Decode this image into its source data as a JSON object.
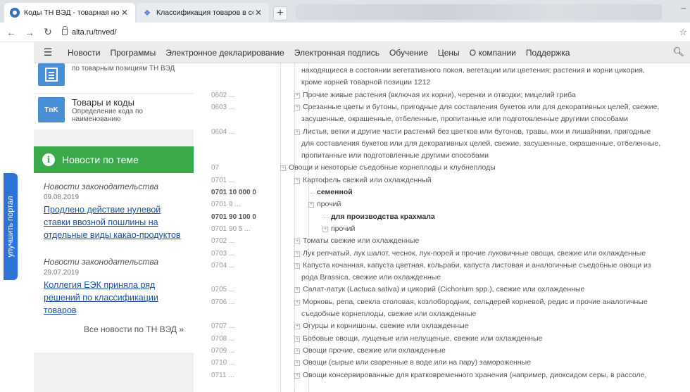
{
  "browser": {
    "tabs": [
      {
        "title": "Коды ТН ВЭД - товарная номе",
        "active": true
      },
      {
        "title": "Классификация товаров в соот",
        "active": false
      }
    ],
    "url": "alta.ru/tnved/"
  },
  "menu": {
    "items": [
      "Новости",
      "Программы",
      "Электронное декларирование",
      "Электронная подпись",
      "Обучение",
      "Цены",
      "О компании",
      "Поддержка"
    ]
  },
  "sidebar": {
    "service1": {
      "subtitle": "по товарным позициям ТН ВЭД"
    },
    "service2": {
      "icon_text": "TnK",
      "title": "Товары и коды",
      "subtitle": "Определение кода по наименованию"
    },
    "news_header": "Новости по теме",
    "news": [
      {
        "category": "Новости законодательства",
        "date": "09.08.2019",
        "link": "Продлено действие нулевой ставки ввозной пошлины на отдельные виды какао-продуктов"
      },
      {
        "category": "Новости законодательства",
        "date": "29.07.2019",
        "link": "Коллегия ЕЭК приняла ряд решений по классификации товаров"
      }
    ],
    "all_news": "Все новости по ТН ВЭД »",
    "side_tab": "улучшить портал"
  },
  "tree": {
    "rows": [
      {
        "code": "",
        "desc": "находящиеся в состоянии вегетативного покоя, вегетации или цветения; растения и корни цикория,",
        "bold": false
      },
      {
        "code": "",
        "desc": "кроме корней товарной позиции 1212",
        "bold": false
      },
      {
        "code": "0602 ...",
        "desc": "Прочие живые растения (включая их корни), черенки и отводки; мицелий гриба",
        "bold": false
      },
      {
        "code": "0603 ...",
        "desc": "Срезанные цветы и бутоны, пригодные для составления букетов или для декоративных целей, свежие,",
        "bold": false
      },
      {
        "code": "",
        "desc": "засушенные, окрашенные, отбеленные, пропитанные или подготовленные другими способами",
        "bold": false
      },
      {
        "code": "0604 ...",
        "desc": "Листья, ветки и другие части растений без цветков или бутонов, травы, мхи и лишайники, пригодные",
        "bold": false
      },
      {
        "code": "",
        "desc": "для составления букетов или для декоративных целей, свежие, засушенные, окрашенные, отбеленные,",
        "bold": false
      },
      {
        "code": "",
        "desc": "пропитанные или подготовленные другими способами",
        "bold": false
      },
      {
        "code": "07",
        "desc": "Овощи и некоторые съедобные корнеплоды и клубнеплоды",
        "bold": false
      },
      {
        "code": "0701 ...",
        "desc": "Картофель свежий или охлажденный",
        "bold": false
      },
      {
        "code": "0701 10 000 0",
        "desc": "семенной",
        "bold": true
      },
      {
        "code": "0701 9 ...",
        "desc": "прочий",
        "bold": false
      },
      {
        "code": "0701 90 100 0",
        "desc": "для производства крахмала",
        "bold": true
      },
      {
        "code": "0701 90 5 ...",
        "desc": "прочий",
        "bold": false
      },
      {
        "code": "0702 ...",
        "desc": "Томаты свежие или охлажденные",
        "bold": false
      },
      {
        "code": "0703 ...",
        "desc": "Лук репчатый, лук шалот, чеснок, лук-порей и прочие луковичные овощи, свежие или охлажденные",
        "bold": false
      },
      {
        "code": "0704 ...",
        "desc": "Капуста кочанная, капуста цветная, кольраби, капуста листовая и аналогичные съедобные овощи из",
        "bold": false
      },
      {
        "code": "",
        "desc": "рода Brassica, свежие или охлажденные",
        "bold": false
      },
      {
        "code": "0705 ...",
        "desc": "Салат-латук (Lactuca sativa) и цикорий (Cichorium spp.), свежие или охлажденные",
        "bold": false
      },
      {
        "code": "0706 ...",
        "desc": "Морковь, репа, свекла столовая, козлобородник, сельдерей корневой, редис и прочие аналогичные",
        "bold": false
      },
      {
        "code": "",
        "desc": "съедобные корнеплоды, свежие или охлажденные",
        "bold": false
      },
      {
        "code": "0707 ...",
        "desc": "Огурцы и корнишоны, свежие или охлажденные",
        "bold": false
      },
      {
        "code": "0708 ...",
        "desc": "Бобовые овощи, лущеные или нелущеные, свежие или охлажденные",
        "bold": false
      },
      {
        "code": "0709 ...",
        "desc": "Овощи прочие, свежие или охлажденные",
        "bold": false
      },
      {
        "code": "0710 ...",
        "desc": "Овощи (сырые или сваренные в воде или на пару) замороженные",
        "bold": false
      },
      {
        "code": "0711 ...",
        "desc": "Овощи консервированные для кратковременного хранения (например, диоксидом серы, в рассоле,",
        "bold": false
      }
    ]
  }
}
